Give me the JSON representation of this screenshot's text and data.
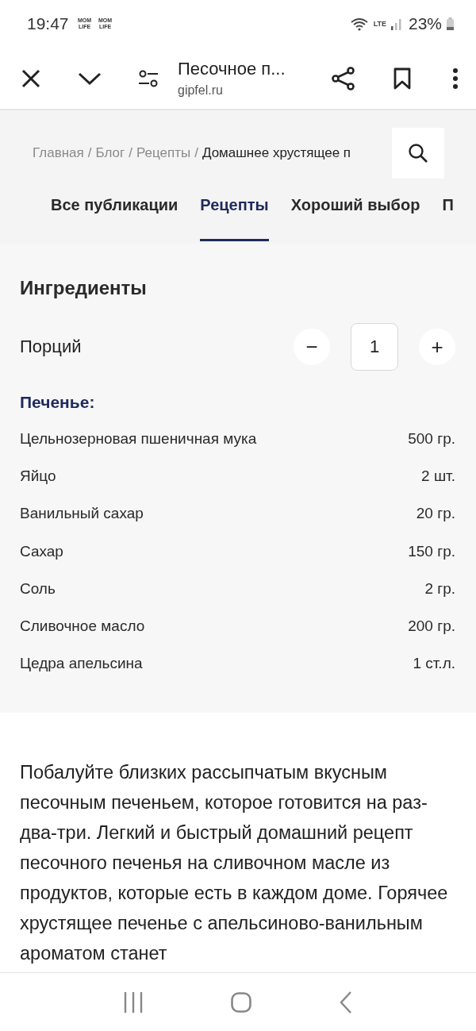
{
  "status_bar": {
    "time": "19:47",
    "notification_icons": [
      "MOM LIFE",
      "MOM LIFE"
    ],
    "network": "LTE",
    "battery": "23%"
  },
  "browser_bar": {
    "title": "Песочное п...",
    "domain": "gipfel.ru"
  },
  "breadcrumbs": [
    {
      "label": "Главная",
      "current": false,
      "separator": "/"
    },
    {
      "label": "Блог",
      "current": false,
      "separator": "/"
    },
    {
      "label": "Рецепты",
      "current": false,
      "separator": "/"
    },
    {
      "label": "Домашнее хрустящее п",
      "current": true
    }
  ],
  "tabs": [
    {
      "label": "Все публикации",
      "selected": false
    },
    {
      "label": "Рецепты",
      "selected": true
    },
    {
      "label": "Хороший выбор",
      "selected": false
    },
    {
      "label": "П",
      "selected": false
    }
  ],
  "ingredients": {
    "title": "Ингредиенты",
    "servings_label": "Порций",
    "servings": "1",
    "decrease": "−",
    "increase": "+",
    "group": "Печенье:",
    "items": [
      {
        "name": "Цельнозерновая пшеничная мука",
        "amount": "500 гр."
      },
      {
        "name": "Яйцо",
        "amount": "2 шт."
      },
      {
        "name": "Ванильный сахар",
        "amount": "20 гр."
      },
      {
        "name": "Сахар",
        "amount": "150 гр."
      },
      {
        "name": "Соль",
        "amount": "2 гр."
      },
      {
        "name": "Сливочное масло",
        "amount": "200 гр."
      },
      {
        "name": "Цедра апельсина",
        "amount": "1 ст.л."
      }
    ]
  },
  "description": "Побалуйте близких рассыпчатым вкусным песочным печеньем, которое готовится на раз-два-три. Легкий и быстрый домашний рецепт песочного печенья на сливочном масле из продуктов, которые есть в каждом доме. Горячее хрустящее печенье с апельсиново-ванильным ароматом станет"
}
